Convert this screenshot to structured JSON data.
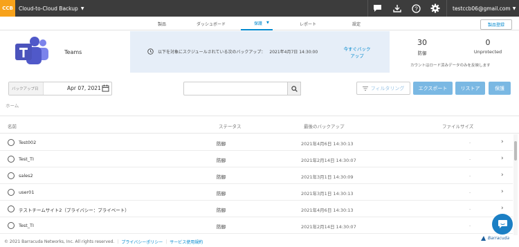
{
  "topbar": {
    "logo": "CCB",
    "app_name": "Cloud-to-Cloud Backup",
    "user": "testccb06@gmail.com",
    "icons": [
      "chat-icon",
      "download-icon",
      "help-icon",
      "gear-icon"
    ]
  },
  "nav": {
    "tabs": [
      "製品",
      "ダッシュボード",
      "保護",
      "レポート",
      "設定"
    ],
    "active": "保護",
    "register": "製品登録"
  },
  "summary": {
    "name": "Teams",
    "schedule_text": "以下を対象にスクジュールされている次のバックアップ：",
    "schedule_time": "2021年4月7日 14:30:00",
    "backup_now": "今すぐバック アップ",
    "protected_count": "30",
    "protected_label": "防御",
    "unprotected_count": "0",
    "unprotected_label": "Unprotected",
    "note": "カウントはロード済みデータのみを反映します"
  },
  "toolbar": {
    "date_label": "バックアップ日",
    "date_value": "Apr 07, 2021",
    "search_placeholder": "",
    "filter": "フィルタリング",
    "export": "エクスポート",
    "restore": "リストア",
    "protect": "保護"
  },
  "breadcrumb": "ホーム",
  "table": {
    "headers": [
      "名前",
      "ステータス",
      "最後のバックアップ",
      "ファイルサイズ"
    ],
    "rows": [
      {
        "name": "Test002",
        "status": "防御",
        "last": "2021年4月6日 14:30:13",
        "size": "-"
      },
      {
        "name": "Test_TI",
        "status": "防御",
        "last": "2021年2月14日 14:30:07",
        "size": "-"
      },
      {
        "name": "sales2",
        "status": "防御",
        "last": "2021年3月1日 14:30:09",
        "size": "-"
      },
      {
        "name": "user01",
        "status": "防御",
        "last": "2021年3月1日 14:30:13",
        "size": "-"
      },
      {
        "name": "テストチームサイト2（プライバシー：プライベート）",
        "status": "防御",
        "last": "2021年4月6日 14:30:13",
        "size": "-"
      },
      {
        "name": "Test_TI",
        "status": "防御",
        "last": "2021年2月14日 14:30:07",
        "size": "-"
      }
    ]
  },
  "footer": {
    "copyright": "© 2021 Barracuda Networks, Inc. All rights reserved.",
    "privacy": "プライバシーポリシー",
    "terms": "サービス使用規約",
    "brand": "Barracuda"
  },
  "colors": {
    "accent": "#0088ce",
    "button": "#7ab8e3",
    "topbar": "#3c3c3c",
    "logo": "#f7a21b",
    "schedule_bg": "#e6eef8"
  }
}
